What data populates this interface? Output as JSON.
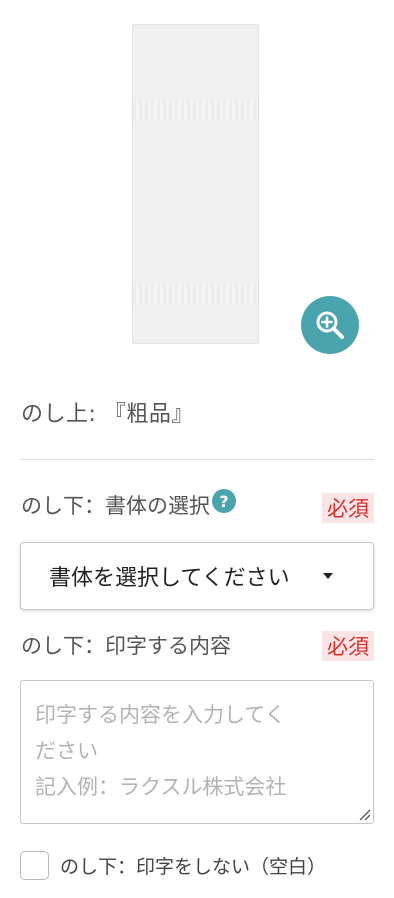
{
  "product": {
    "image_alt": "towel",
    "zoom_icon": "zoom-in-icon"
  },
  "noshi_upper": {
    "text": "のし上: 『粗品』"
  },
  "font_field": {
    "label": "のし下：書体の選択",
    "help_icon_glyph": "?",
    "required": "必須",
    "selected_value": "書体を選択してください"
  },
  "print_field": {
    "label": "のし下：印字する内容",
    "required": "必須",
    "placeholder_line1": "印字する内容を入力してく",
    "placeholder_line2": "ださい",
    "placeholder_line3": "記入例：ラクスル株式会社",
    "placeholder": "印字する内容を入力してください\n記入例：ラクスル株式会社"
  },
  "no_print_option": {
    "label": "のし下：印字をしない（空白）",
    "checked": false
  },
  "colors": {
    "accent": "#4aa4ae",
    "required_text": "#d62f2f",
    "required_bg": "#fbe4e6"
  }
}
